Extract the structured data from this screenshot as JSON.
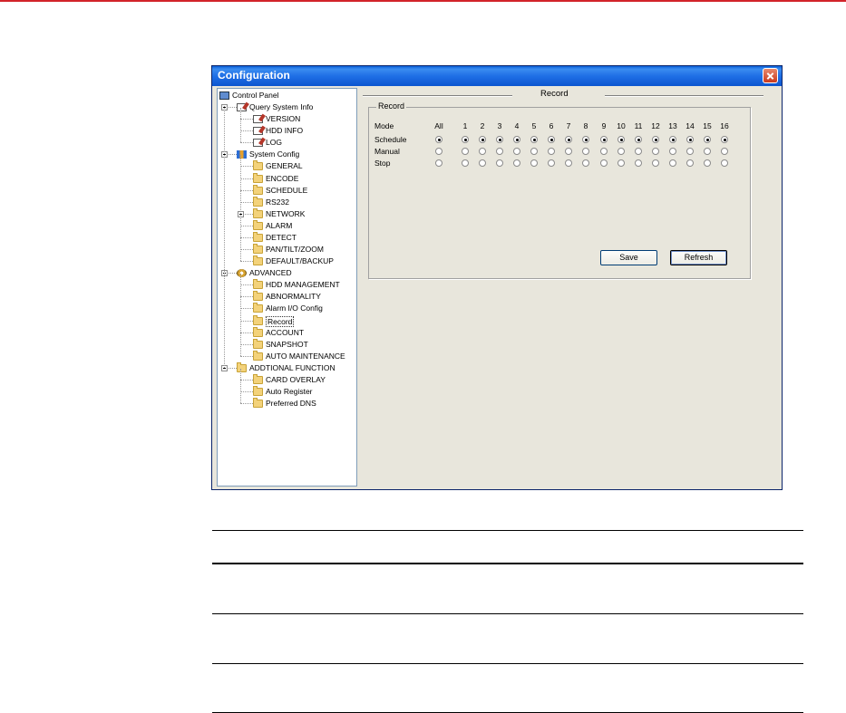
{
  "window": {
    "title": "Configuration"
  },
  "tree": {
    "items": [
      {
        "label": "Control Panel",
        "icon": "monitor-icon",
        "level": 0
      },
      {
        "label": "Query System Info",
        "icon": "document-icon",
        "level": 1,
        "toggle": "minus"
      },
      {
        "label": "VERSION",
        "icon": "document-icon",
        "level": 2
      },
      {
        "label": "HDD INFO",
        "icon": "document-icon",
        "level": 2
      },
      {
        "label": "LOG",
        "icon": "document-icon",
        "level": 2
      },
      {
        "label": "System Config",
        "icon": "config-icon",
        "level": 1,
        "toggle": "minus"
      },
      {
        "label": "GENERAL",
        "icon": "folder-icon",
        "level": 2
      },
      {
        "label": "ENCODE",
        "icon": "folder-icon",
        "level": 2
      },
      {
        "label": "SCHEDULE",
        "icon": "folder-icon",
        "level": 2
      },
      {
        "label": "RS232",
        "icon": "folder-icon",
        "level": 2
      },
      {
        "label": "NETWORK",
        "icon": "folder-icon",
        "level": 2,
        "toggle": "plus"
      },
      {
        "label": "ALARM",
        "icon": "folder-icon",
        "level": 2
      },
      {
        "label": "DETECT",
        "icon": "folder-icon",
        "level": 2
      },
      {
        "label": "PAN/TILT/ZOOM",
        "icon": "folder-icon",
        "level": 2
      },
      {
        "label": "DEFAULT/BACKUP",
        "icon": "folder-icon",
        "level": 2
      },
      {
        "label": "ADVANCED",
        "icon": "gears-icon",
        "level": 1,
        "toggle": "minus"
      },
      {
        "label": "HDD MANAGEMENT",
        "icon": "folder-icon",
        "level": 2
      },
      {
        "label": "ABNORMALITY",
        "icon": "folder-icon",
        "level": 2
      },
      {
        "label": "Alarm I/O Config",
        "icon": "folder-icon",
        "level": 2
      },
      {
        "label": "Record",
        "icon": "folder-open-icon",
        "level": 2,
        "selected": true
      },
      {
        "label": "ACCOUNT",
        "icon": "folder-icon",
        "level": 2
      },
      {
        "label": "SNAPSHOT",
        "icon": "folder-icon",
        "level": 2
      },
      {
        "label": "AUTO MAINTENANCE",
        "icon": "folder-icon",
        "level": 2
      },
      {
        "label": "ADDTIONAL FUNCTION",
        "icon": "folder-icon",
        "level": 1,
        "toggle": "minus"
      },
      {
        "label": "CARD OVERLAY",
        "icon": "folder-icon",
        "level": 2
      },
      {
        "label": "Auto Register",
        "icon": "folder-icon",
        "level": 2
      },
      {
        "label": "Preferred DNS",
        "icon": "folder-icon",
        "level": 2
      }
    ]
  },
  "panel": {
    "title": "Record",
    "group_title": "Record",
    "mode_label": "Mode",
    "columns": [
      "All",
      "1",
      "2",
      "3",
      "4",
      "5",
      "6",
      "7",
      "8",
      "9",
      "10",
      "11",
      "12",
      "13",
      "14",
      "15",
      "16"
    ],
    "rows": [
      {
        "label": "Schedule",
        "selected": true
      },
      {
        "label": "Manual",
        "selected": false
      },
      {
        "label": "Stop",
        "selected": false
      }
    ],
    "save_label": "Save",
    "refresh_label": "Refresh"
  },
  "colors": {
    "accent_rule": "#d2232a",
    "titlebar": "#0c55cf",
    "window_bg": "#e8e6dc"
  }
}
